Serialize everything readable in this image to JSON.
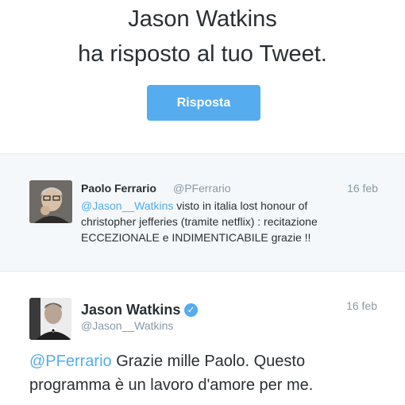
{
  "notification": {
    "line1": "Jason Watkins",
    "line2": "ha risposto al tuo Tweet.",
    "reply_button_label": "Risposta"
  },
  "quoted_tweet": {
    "author_name": "Paolo Ferrario",
    "author_handle": "@PFerrario",
    "date": "16 feb",
    "mention": "@Jason__Watkins",
    "text": " visto in italia lost honour of christopher jefferies (tramite netflix) : recitazione ECCEZIONALE e INDIMENTICABILE grazie !!"
  },
  "reply_tweet": {
    "author_name": "Jason Watkins",
    "author_handle": "@Jason__Watkins",
    "date": "16 feb",
    "verified_badge_icon": "verified-check-icon",
    "mention": "@PFerrario",
    "text": " Grazie mille Paolo. Questo programma è un lavoro d'amore per me."
  },
  "colors": {
    "accent": "#55acee",
    "text": "#292f33",
    "muted": "#8899a6",
    "quoted_background": "#f5f8fa",
    "divider": "#e1e8ed"
  }
}
